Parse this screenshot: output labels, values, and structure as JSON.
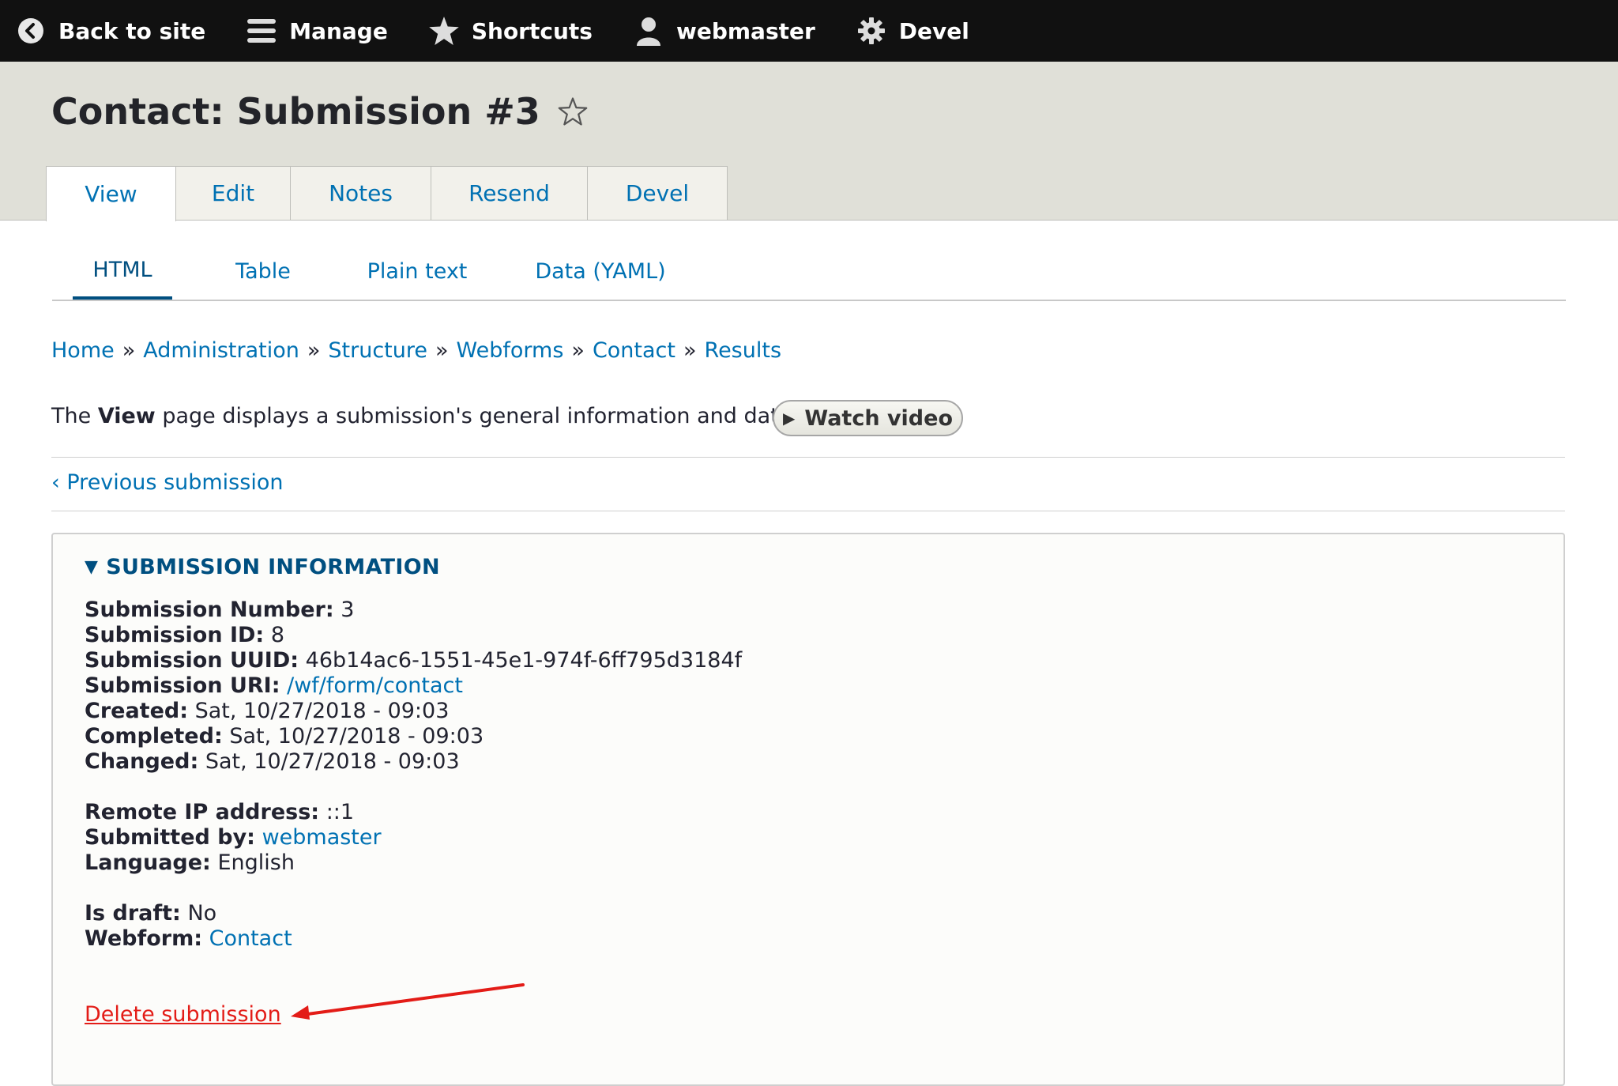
{
  "toolbar": {
    "back": "Back to site",
    "manage": "Manage",
    "shortcuts": "Shortcuts",
    "user": "webmaster",
    "devel": "Devel"
  },
  "page": {
    "title": "Contact: Submission #3"
  },
  "tabs": [
    "View",
    "Edit",
    "Notes",
    "Resend",
    "Devel"
  ],
  "subtabs": [
    "HTML",
    "Table",
    "Plain text",
    "Data (YAML)"
  ],
  "breadcrumb": [
    "Home",
    "Administration",
    "Structure",
    "Webforms",
    "Contact",
    "Results"
  ],
  "help": {
    "prefix": "The ",
    "bold": "View",
    "suffix": " page displays a submission's general information and data.",
    "button": "Watch video"
  },
  "nav": {
    "previous": "‹ Previous submission"
  },
  "details": {
    "summary": "SUBMISSION INFORMATION",
    "number_label": "Submission Number:",
    "number": "3",
    "id_label": "Submission ID:",
    "id": "8",
    "uuid_label": "Submission UUID:",
    "uuid": "46b14ac6-1551-45e1-974f-6ff795d3184f",
    "uri_label": "Submission URI:",
    "uri": "/wf/form/contact",
    "created_label": "Created:",
    "created": "Sat, 10/27/2018 - 09:03",
    "completed_label": "Completed:",
    "completed": "Sat, 10/27/2018 - 09:03",
    "changed_label": "Changed:",
    "changed": "Sat, 10/27/2018 - 09:03",
    "ip_label": "Remote IP address:",
    "ip": "::1",
    "by_label": "Submitted by:",
    "by": "webmaster",
    "lang_label": "Language:",
    "lang": "English",
    "draft_label": "Is draft:",
    "draft": "No",
    "webform_label": "Webform:",
    "webform": "Contact",
    "delete": "Delete submission"
  },
  "colors": {
    "link": "#0071b3",
    "toolbar": "#111111",
    "header": "#e0e0d8",
    "delete": "#e31c17",
    "annotation_arrow": "#e31c17"
  }
}
